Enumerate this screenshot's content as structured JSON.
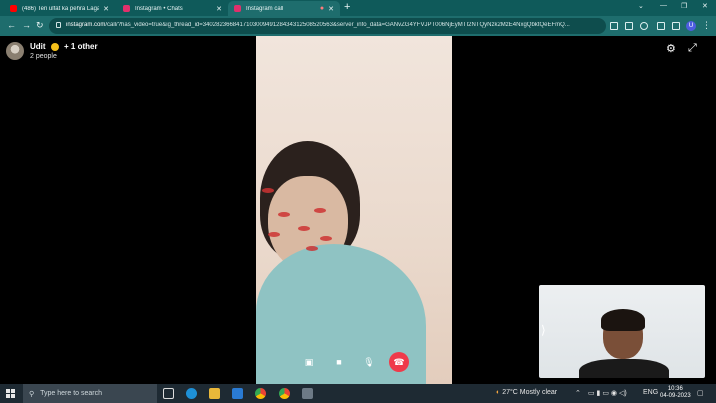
{
  "tabs": [
    {
      "label": "(486) Teri ulfat ka pehra Laga hai",
      "favicon_color": "#ff0000"
    },
    {
      "label": "Instagram • Chats",
      "favicon_color": "#e1306c"
    },
    {
      "label": "Instagram call",
      "favicon_color": "#e1306c"
    }
  ],
  "address": {
    "host": "instagram.com",
    "path": "/call/?has_video=true&ig_thread_id=340282366841710300949128434312508520563&server_info_data=GANvZG4YFVJPT006NjEyMTI2NTQyNzk2MzE4NxgQbktQeEFmQ..."
  },
  "caller": {
    "name": "Udit",
    "extra": "+ 1 other",
    "subtitle": "2 people"
  },
  "controls": [
    "screen-share",
    "camera",
    "microphone",
    "end-call"
  ],
  "taskbar": {
    "search_placeholder": "Type here to search",
    "weather": "27°C  Mostly clear",
    "lang": "ENG",
    "time": "10:36",
    "date": "04-09-2023"
  },
  "colors": {
    "tabstrip": "#0f5a5a",
    "toolbar": "#1e6d6d",
    "end_call": "#ef3a4a"
  }
}
